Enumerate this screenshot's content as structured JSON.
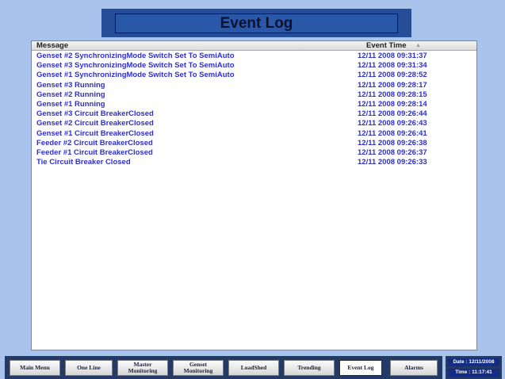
{
  "header": {
    "title": "Event Log"
  },
  "log": {
    "columns": {
      "message": "Message",
      "event_time": "Event Time"
    },
    "sort_icon": "sort-ascending-icon",
    "rows": [
      {
        "message": "Genset #2 SynchronizingMode Switch Set To SemiAuto",
        "time": "12/11 2008 09:31:37"
      },
      {
        "message": "Genset #3 SynchronizingMode Switch Set To SemiAuto",
        "time": "12/11 2008 09:31:34"
      },
      {
        "message": "Genset #1 SynchronizingMode Switch Set To SemiAuto",
        "time": "12/11 2008 09:28:52"
      },
      {
        "message": "Genset #3 Running",
        "time": "12/11 2008 09:28:17"
      },
      {
        "message": "Genset #2 Running",
        "time": "12/11 2008 09:28:15"
      },
      {
        "message": "Genset #1 Running",
        "time": "12/11 2008 09:28:14"
      },
      {
        "message": "Genset #3 Circuit BreakerClosed",
        "time": "12/11 2008 09:26:44"
      },
      {
        "message": "Genset #2 Circuit BreakerClosed",
        "time": "12/11 2008 09:26:43"
      },
      {
        "message": "Genset #1 Circuit BreakerClosed",
        "time": "12/11 2008 09:26:41"
      },
      {
        "message": "Feeder #2 Circuit BreakerClosed",
        "time": "12/11 2008 09:26:38"
      },
      {
        "message": "Feeder #1 Circuit BreakerClosed",
        "time": "12/11 2008 09:26:37"
      },
      {
        "message": "Tie Circuit Breaker Closed",
        "time": "12/11 2008 09:26:33"
      }
    ]
  },
  "nav": {
    "main_menu": "Main Menu",
    "one_line": "One Line",
    "master_monitoring_1": "Master",
    "master_monitoring_2": "Monitoring",
    "genset_monitoring_1": "Genset",
    "genset_monitoring_2": "Monitoring",
    "loadshed": "LoadShed",
    "trending": "Trending",
    "event_log": "Event Log",
    "alarms": "Alarms"
  },
  "status": {
    "date": "Date : 12/11/2008",
    "time": "Time : 11:17:41"
  },
  "colors": {
    "background": "#a9c3ec",
    "title_bar": "#264d97",
    "log_text": "#2e2fd2",
    "nav_bar": "#243a66",
    "status_box": "#132c86"
  }
}
